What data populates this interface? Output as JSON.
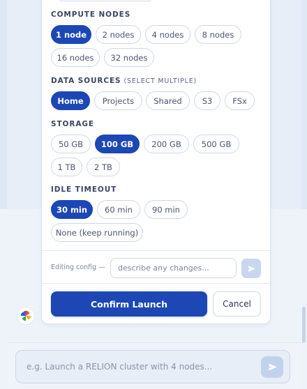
{
  "compute_nodes": {
    "title": "COMPUTE NODES",
    "options": [
      "1 node",
      "2 nodes",
      "4 nodes",
      "8 nodes",
      "16 nodes",
      "32 nodes"
    ],
    "selected": "1 node"
  },
  "data_sources": {
    "title": "DATA SOURCES",
    "subtitle": "(SELECT MULTIPLE)",
    "options": [
      "Home",
      "Projects",
      "Shared",
      "S3",
      "FSx"
    ],
    "selected": [
      "Home"
    ]
  },
  "storage": {
    "title": "STORAGE",
    "options": [
      "50 GB",
      "100 GB",
      "200 GB",
      "500 GB",
      "1 TB",
      "2 TB"
    ],
    "selected": "100 GB"
  },
  "idle_timeout": {
    "title": "IDLE TIMEOUT",
    "options": [
      "30 min",
      "60 min",
      "90 min",
      "None (keep running)"
    ],
    "selected": "30 min"
  },
  "edit_config": {
    "label": "Editing config —",
    "placeholder": "describe any changes..."
  },
  "actions": {
    "confirm_label": "Confirm Launch",
    "cancel_label": "Cancel"
  },
  "chat": {
    "placeholder": "e.g. Launch a RELION cluster with 4 nodes..."
  },
  "icons": {
    "send": "send-arrow-icon",
    "assistant_avatar": "pinwheel-logo-icon"
  },
  "colors": {
    "accent": "#1c47b5",
    "send_button_disabled": "#c3d2ec"
  }
}
